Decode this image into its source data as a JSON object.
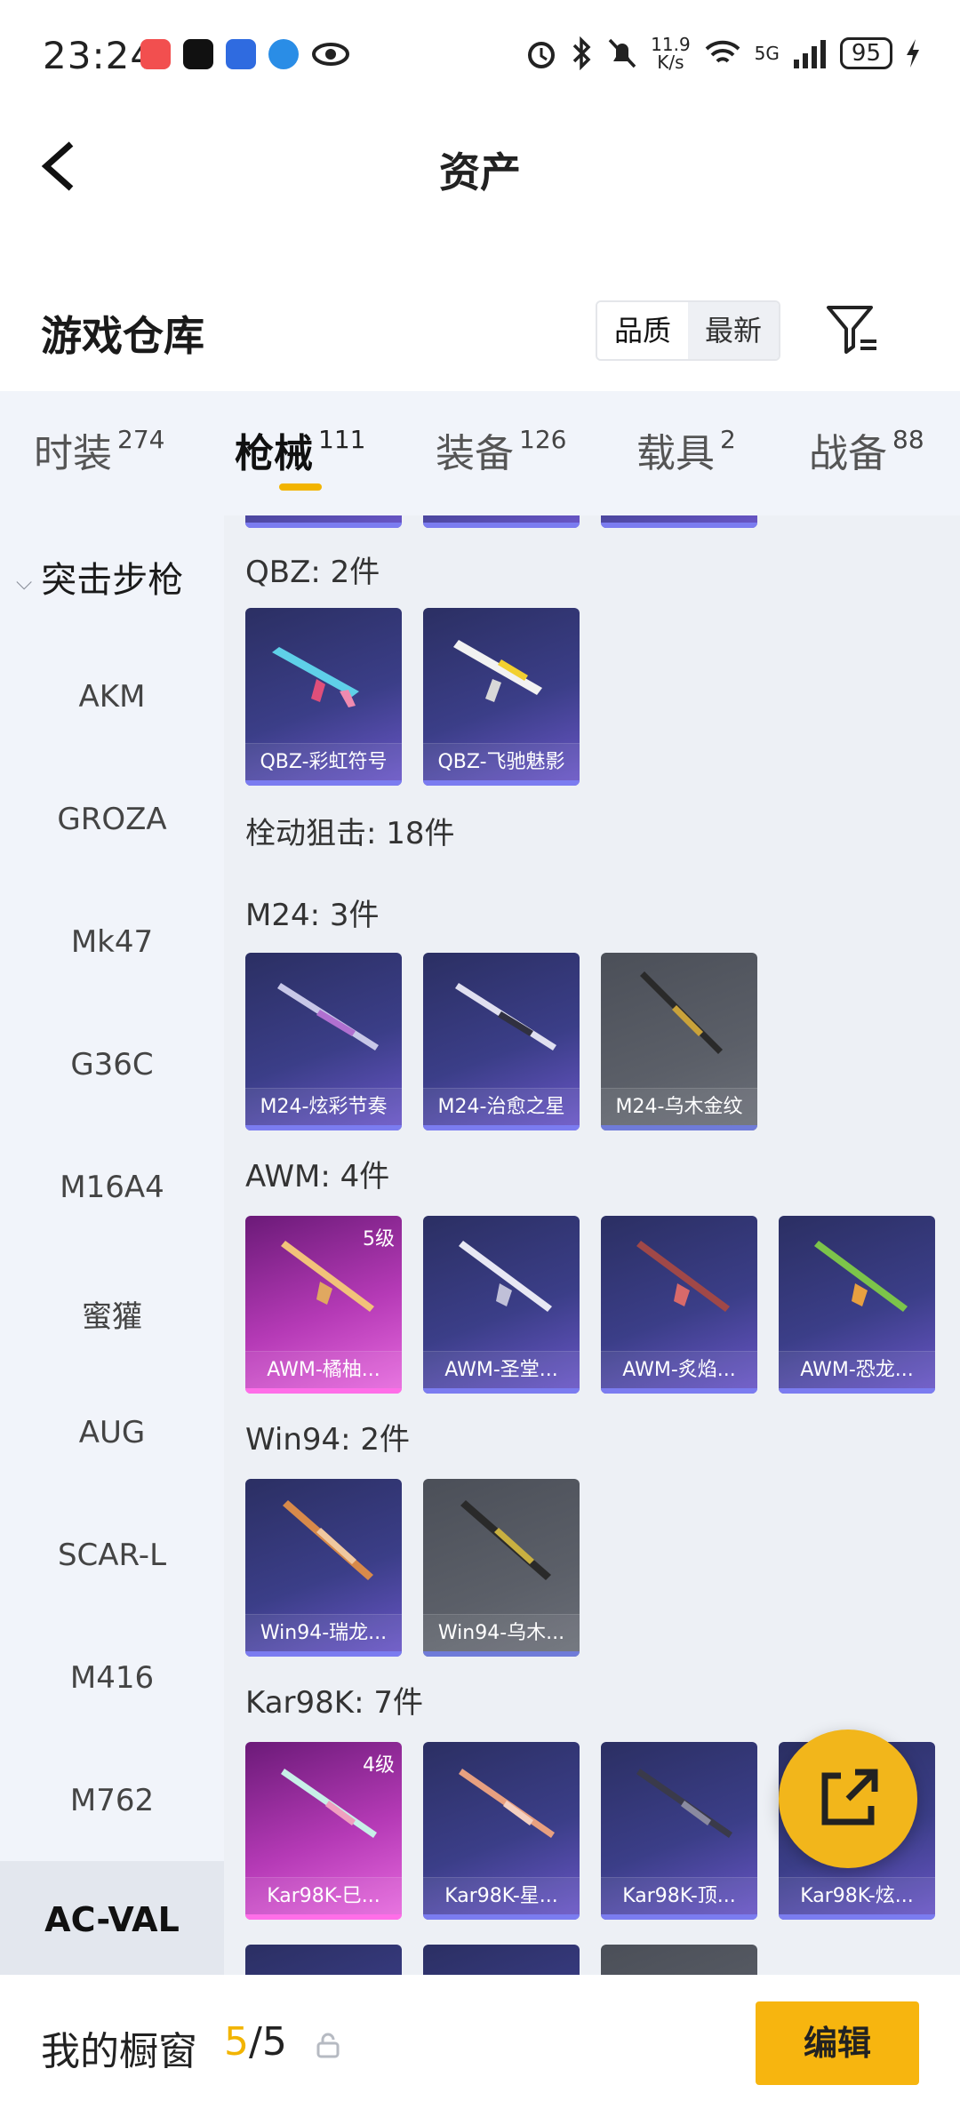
{
  "status_bar": {
    "time": "23:24",
    "net_speed_top": "11.9",
    "net_speed_unit": "K/s",
    "signal_label": "5G",
    "battery": "95"
  },
  "header": {
    "title": "资产"
  },
  "warehouse": {
    "title": "游戏仓库",
    "sort_options": [
      "品质",
      "最新"
    ],
    "sort_selected": "品质"
  },
  "tabs": [
    {
      "label": "时装",
      "count": "274"
    },
    {
      "label": "枪械",
      "count": "111"
    },
    {
      "label": "装备",
      "count": "126"
    },
    {
      "label": "载具",
      "count": "2"
    },
    {
      "label": "战备",
      "count": "88"
    }
  ],
  "sidebar": {
    "group": "突击步枪",
    "items": [
      "AKM",
      "GROZA",
      "Mk47",
      "G36C",
      "M16A4",
      "蜜獾",
      "AUG",
      "SCAR-L",
      "M416",
      "M762",
      "AC-VAL"
    ],
    "active": "AC-VAL"
  },
  "sections": {
    "qbz": "QBZ: 2件",
    "bolt": "栓动狙击: 18件",
    "m24": "M24: 3件",
    "awm": "AWM: 4件",
    "win94": "Win94: 2件",
    "kar98k": "Kar98K: 7件"
  },
  "cards": {
    "qbz": [
      "QBZ-彩虹符号",
      "QBZ-飞驰魅影"
    ],
    "m24": [
      "M24-炫彩节奏",
      "M24-治愈之星",
      "M24-乌木金纹"
    ],
    "awm": [
      "AWM-橘柚...",
      "AWM-圣堂...",
      "AWM-炙焰...",
      "AWM-恐龙..."
    ],
    "awm_level": "5级",
    "win94": [
      "Win94-瑞龙...",
      "Win94-乌木..."
    ],
    "kar98k": [
      "Kar98K-巳...",
      "Kar98K-星...",
      "Kar98K-顶...",
      "Kar98K-炫..."
    ],
    "kar98k_level": "4级"
  },
  "bottom": {
    "showcase_label": "我的橱窗",
    "showcase_current": "5",
    "showcase_total": "/5",
    "edit_label": "编辑"
  }
}
